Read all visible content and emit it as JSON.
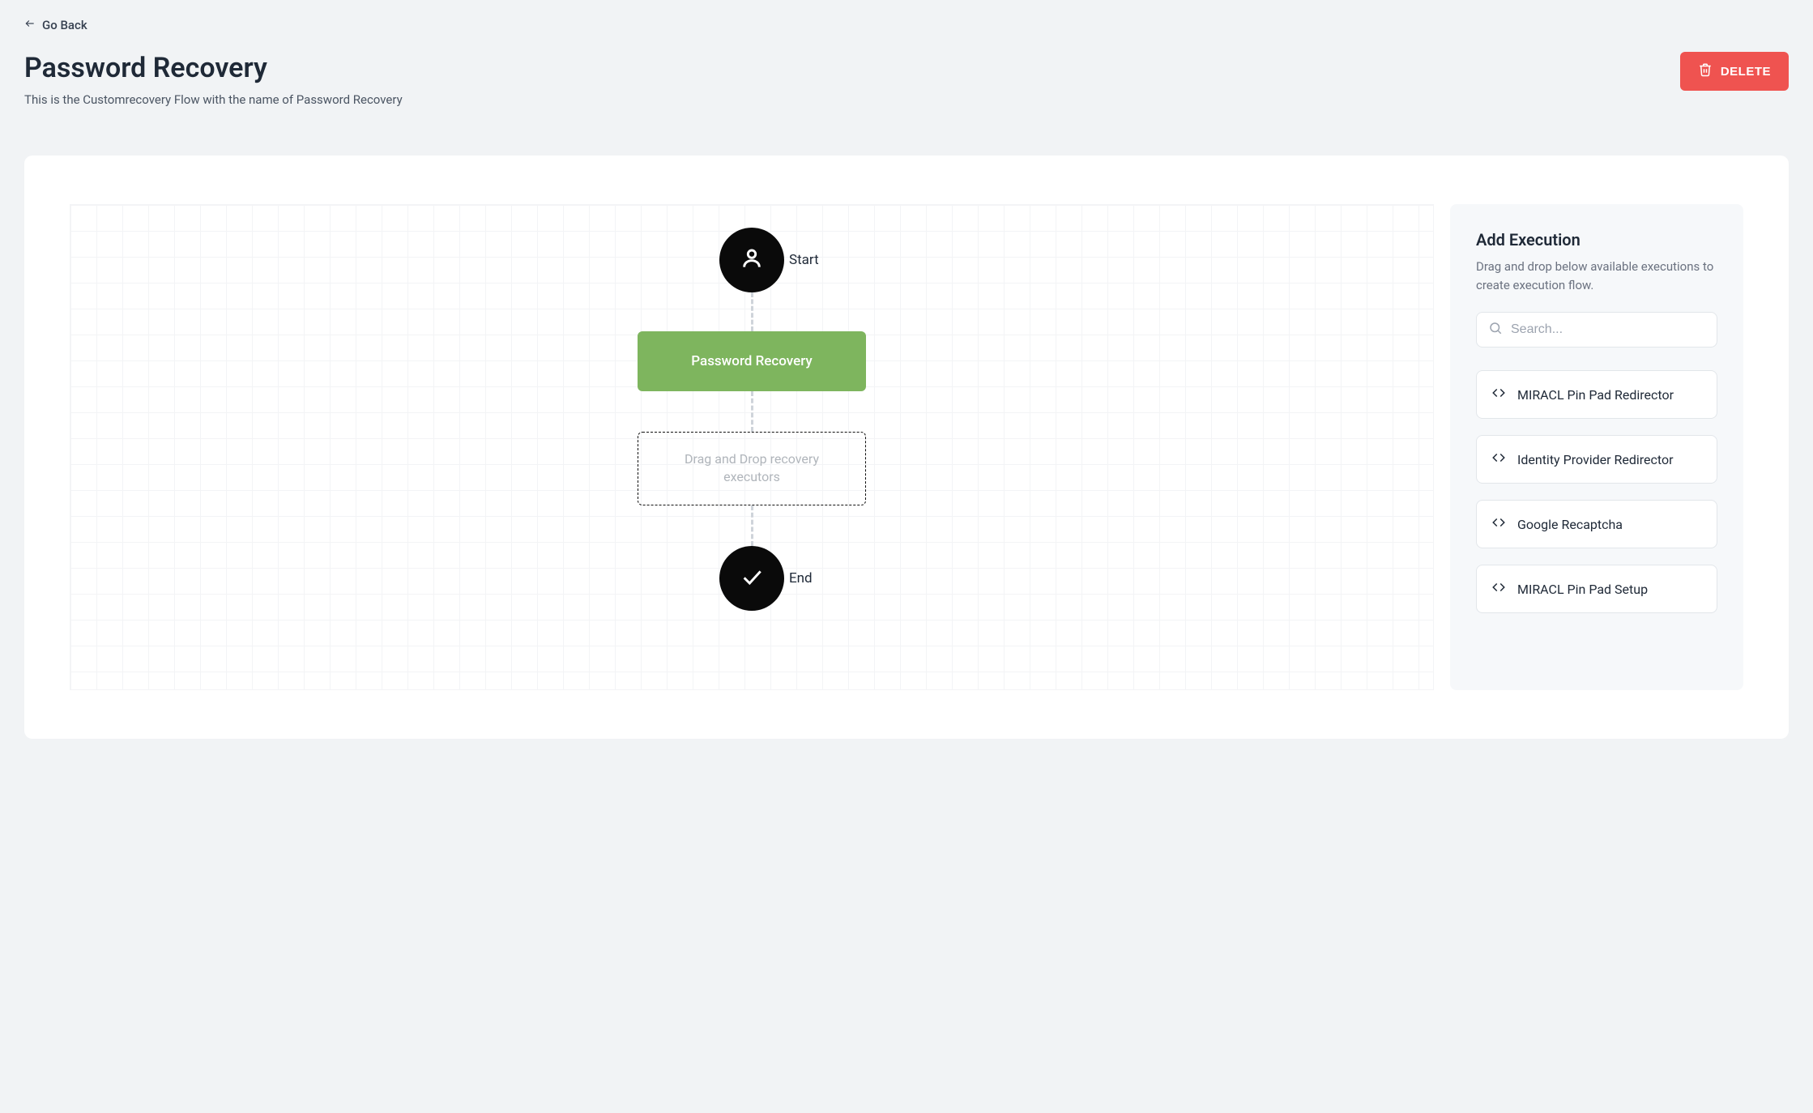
{
  "nav": {
    "go_back": "Go Back"
  },
  "header": {
    "title": "Password Recovery",
    "subtitle": "This is the Customrecovery Flow with the name of Password Recovery",
    "delete_label": "DELETE"
  },
  "flow": {
    "start_label": "Start",
    "block_label": "Password Recovery",
    "dropzone_text": "Drag and Drop recovery executors",
    "end_label": "End"
  },
  "panel": {
    "title": "Add Execution",
    "description": "Drag and drop below available executions to create execution flow.",
    "search_placeholder": "Search...",
    "executions": [
      {
        "label": "MIRACL Pin Pad Redirector"
      },
      {
        "label": "Identity Provider Redirector"
      },
      {
        "label": "Google Recaptcha"
      },
      {
        "label": "MIRACL Pin Pad Setup"
      }
    ]
  }
}
